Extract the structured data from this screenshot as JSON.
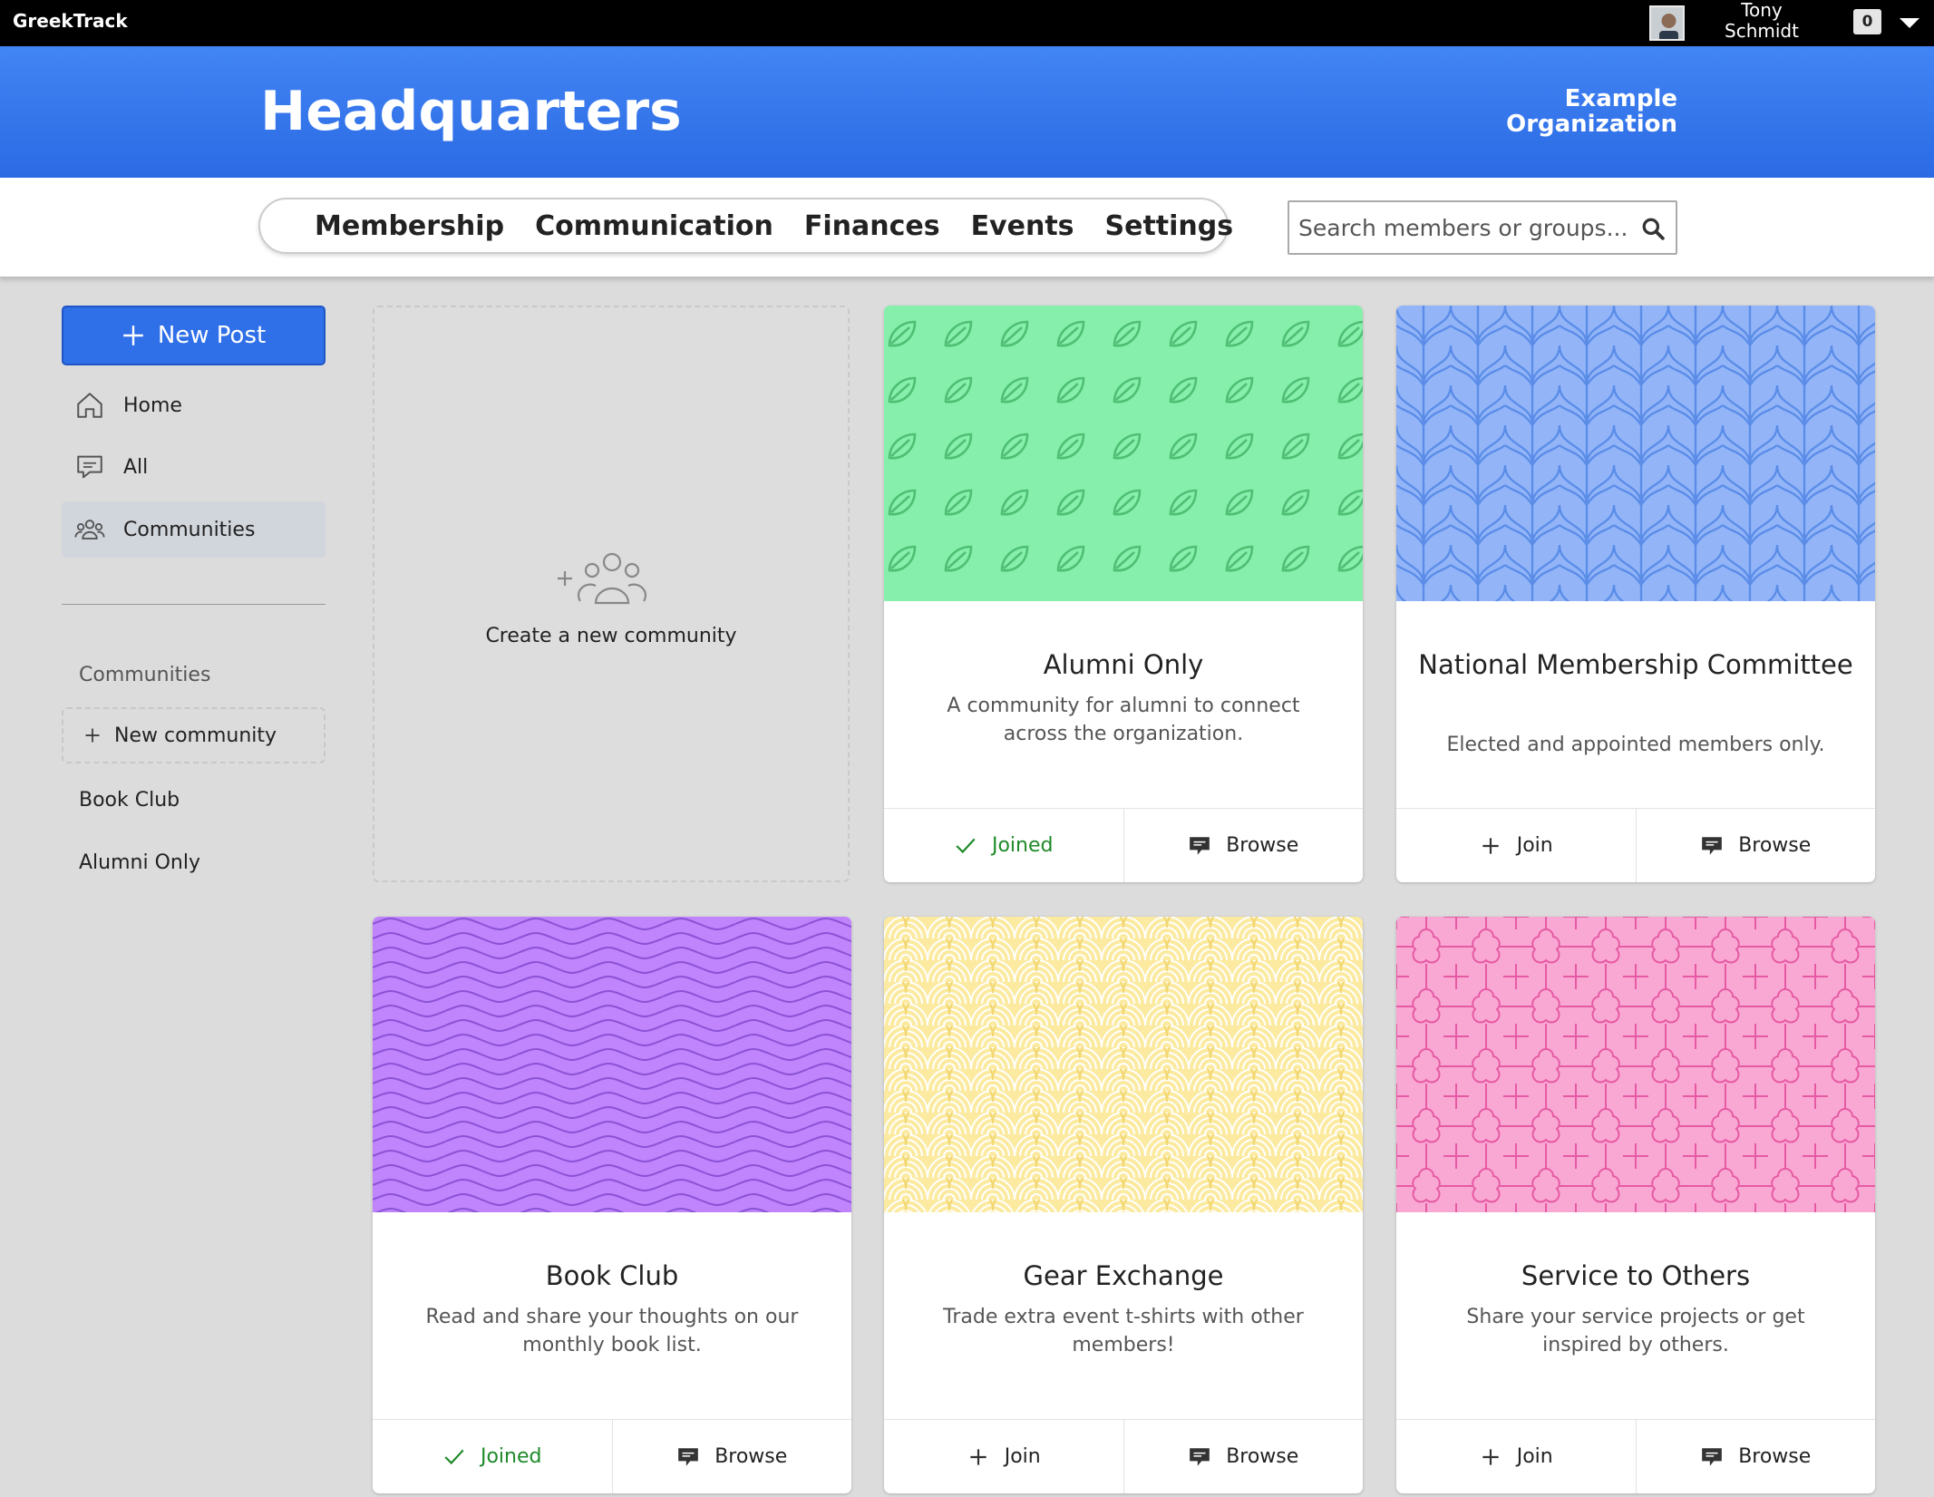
{
  "app": {
    "brand": "GreekTrack"
  },
  "user": {
    "name": "Tony Schmidt",
    "notifications": "0"
  },
  "header": {
    "title": "Headquarters",
    "organization": "Example Organization"
  },
  "nav": {
    "items": [
      "Membership",
      "Communication",
      "Finances",
      "Events",
      "Settings"
    ]
  },
  "search": {
    "placeholder": "Search members or groups..."
  },
  "sidebar": {
    "new_post": "New Post",
    "items": [
      {
        "label": "Home"
      },
      {
        "label": "All"
      },
      {
        "label": "Communities"
      }
    ],
    "communities_label": "Communities",
    "new_community": "New community",
    "links": [
      "Book Club",
      "Alumni Only"
    ]
  },
  "create_community": {
    "label": "Create a new community"
  },
  "cards": [
    {
      "title": "Alumni Only",
      "description": "A community for alumni to connect across the organization.",
      "primary": "Joined",
      "secondary": "Browse",
      "color": "#86efac",
      "pattern": "leaf"
    },
    {
      "title": "National Membership Committee",
      "description": "Elected and appointed members only.",
      "primary": "Join",
      "secondary": "Browse",
      "color": "#93b5f8",
      "pattern": "chevron"
    },
    {
      "title": "Book Club",
      "description": "Read and share your thoughts on our monthly book list.",
      "primary": "Joined",
      "secondary": "Browse",
      "color": "#c084fc",
      "pattern": "wave"
    },
    {
      "title": "Gear Exchange",
      "description": "Trade extra event t-shirts with other members!",
      "primary": "Join",
      "secondary": "Browse",
      "color": "#fbeaa0",
      "pattern": "scales"
    },
    {
      "title": "Service to Others",
      "description": "Share your service projects or get inspired by others.",
      "primary": "Join",
      "secondary": "Browse",
      "color": "#f9a8d4",
      "pattern": "quatrefoil"
    }
  ],
  "colors": {
    "accent": "#2f6fe8",
    "joined": "#1e8a2a",
    "header_blue": "#3478f0"
  }
}
